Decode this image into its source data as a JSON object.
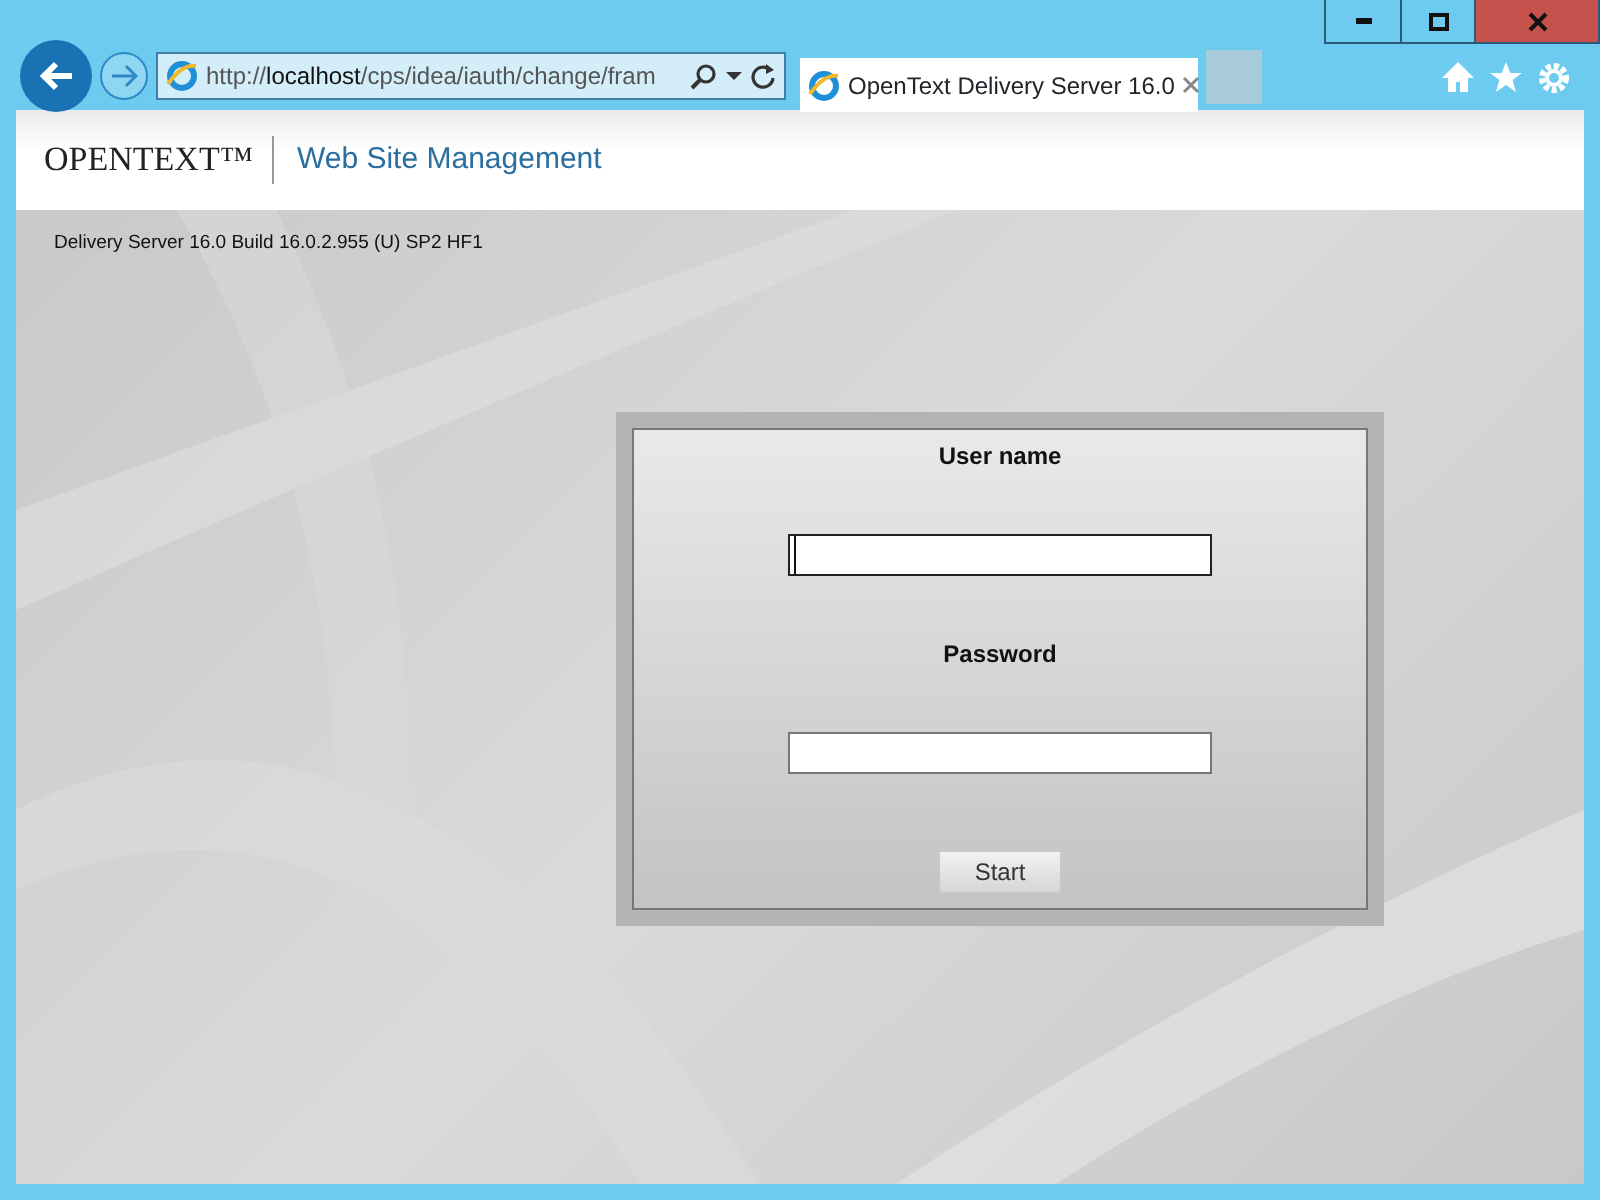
{
  "browser": {
    "address": {
      "prefix": "http://",
      "host": "localhost",
      "path": "/cps/idea/iauth/change/fram"
    },
    "tabs": [
      {
        "label": "OpenText Delivery Server 16.0",
        "selected": true
      }
    ]
  },
  "header": {
    "logo": "OPENTEXT™",
    "title": "Web Site Management"
  },
  "version": "Delivery Server 16.0 Build 16.0.2.955 (U) SP2 HF1",
  "login": {
    "fields": [
      {
        "label": "User name",
        "focused": true
      },
      {
        "label": "Password",
        "focused": false
      }
    ],
    "button": "Start"
  }
}
